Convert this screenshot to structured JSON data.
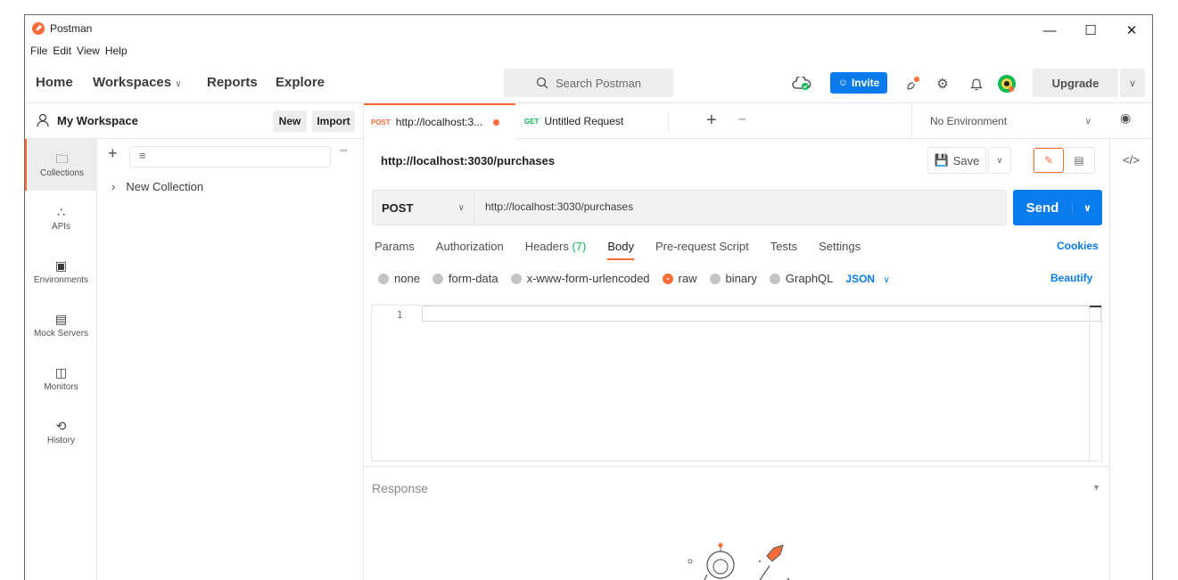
{
  "app": {
    "title": "Postman"
  },
  "menu": [
    "File",
    "Edit",
    "View",
    "Help"
  ],
  "window_controls": {
    "minimize": "—",
    "maximize": "☐",
    "close": "✕"
  },
  "header": {
    "nav": [
      "Home",
      "Workspaces",
      "Reports",
      "Explore"
    ],
    "search_placeholder": "Search Postman",
    "invite_label": "Invite",
    "upgrade_label": "Upgrade"
  },
  "workspace": {
    "name": "My Workspace",
    "new_label": "New",
    "import_label": "Import"
  },
  "sidebar": {
    "items": [
      {
        "label": "Collections",
        "icon": "collections-icon",
        "active": true
      },
      {
        "label": "APIs",
        "icon": "apis-icon"
      },
      {
        "label": "Environments",
        "icon": "environments-icon"
      },
      {
        "label": "Mock Servers",
        "icon": "mock-servers-icon"
      },
      {
        "label": "Monitors",
        "icon": "monitors-icon"
      },
      {
        "label": "History",
        "icon": "history-icon"
      }
    ],
    "collection_name": "New Collection"
  },
  "tabs": [
    {
      "method": "POST",
      "label": "http://localhost:3...",
      "method_color": "#ff6c37",
      "unsaved": true
    },
    {
      "method": "GET",
      "label": "Untitled Request",
      "method_color": "#0cbb52"
    }
  ],
  "environment": {
    "selected": "No Environment"
  },
  "request": {
    "title": "http://localhost:3030/purchases",
    "save_label": "Save",
    "method": "POST",
    "url": "http://localhost:3030/purchases",
    "send_label": "Send",
    "subtabs": [
      {
        "label": "Params"
      },
      {
        "label": "Authorization"
      },
      {
        "label": "Headers",
        "count": "(7)"
      },
      {
        "label": "Body",
        "active": true
      },
      {
        "label": "Pre-request Script"
      },
      {
        "label": "Tests"
      },
      {
        "label": "Settings"
      }
    ],
    "cookies_label": "Cookies",
    "body_options": [
      "none",
      "form-data",
      "x-www-form-urlencoded",
      "raw",
      "binary",
      "GraphQL"
    ],
    "body_selected": "raw",
    "body_format": "JSON",
    "beautify_label": "Beautify",
    "editor_line": "1"
  },
  "response": {
    "label": "Response"
  }
}
